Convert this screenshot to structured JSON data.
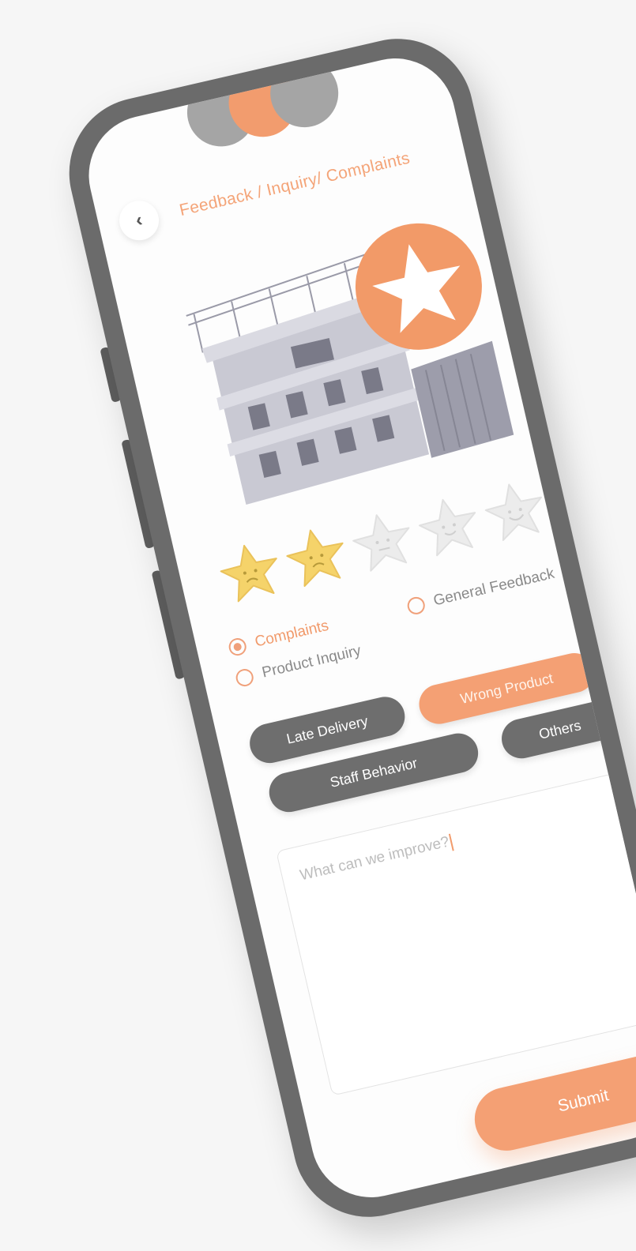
{
  "header": {
    "back_icon": "chevron-left-icon",
    "title": "Feedback / Inquiry/ Complaints"
  },
  "rating": {
    "value": 2,
    "max": 5,
    "filled_color": "#f5d36a",
    "empty_color": "#e6e6e6"
  },
  "categories": {
    "options": [
      {
        "label": "Complaints",
        "checked": true
      },
      {
        "label": "General Feedback",
        "checked": false
      },
      {
        "label": "Product Inquiry",
        "checked": false
      }
    ]
  },
  "tags": [
    {
      "label": "Late Delivery",
      "selected": false
    },
    {
      "label": "Wrong Product",
      "selected": true
    },
    {
      "label": "Staff Behavior",
      "selected": false
    },
    {
      "label": "Others",
      "selected": false
    }
  ],
  "feedback": {
    "placeholder": "What can we improve?"
  },
  "submit_label": "Submit",
  "colors": {
    "accent": "#f4a074",
    "dark_chip": "#6e6e6e",
    "frame": "#6b6b6b"
  }
}
